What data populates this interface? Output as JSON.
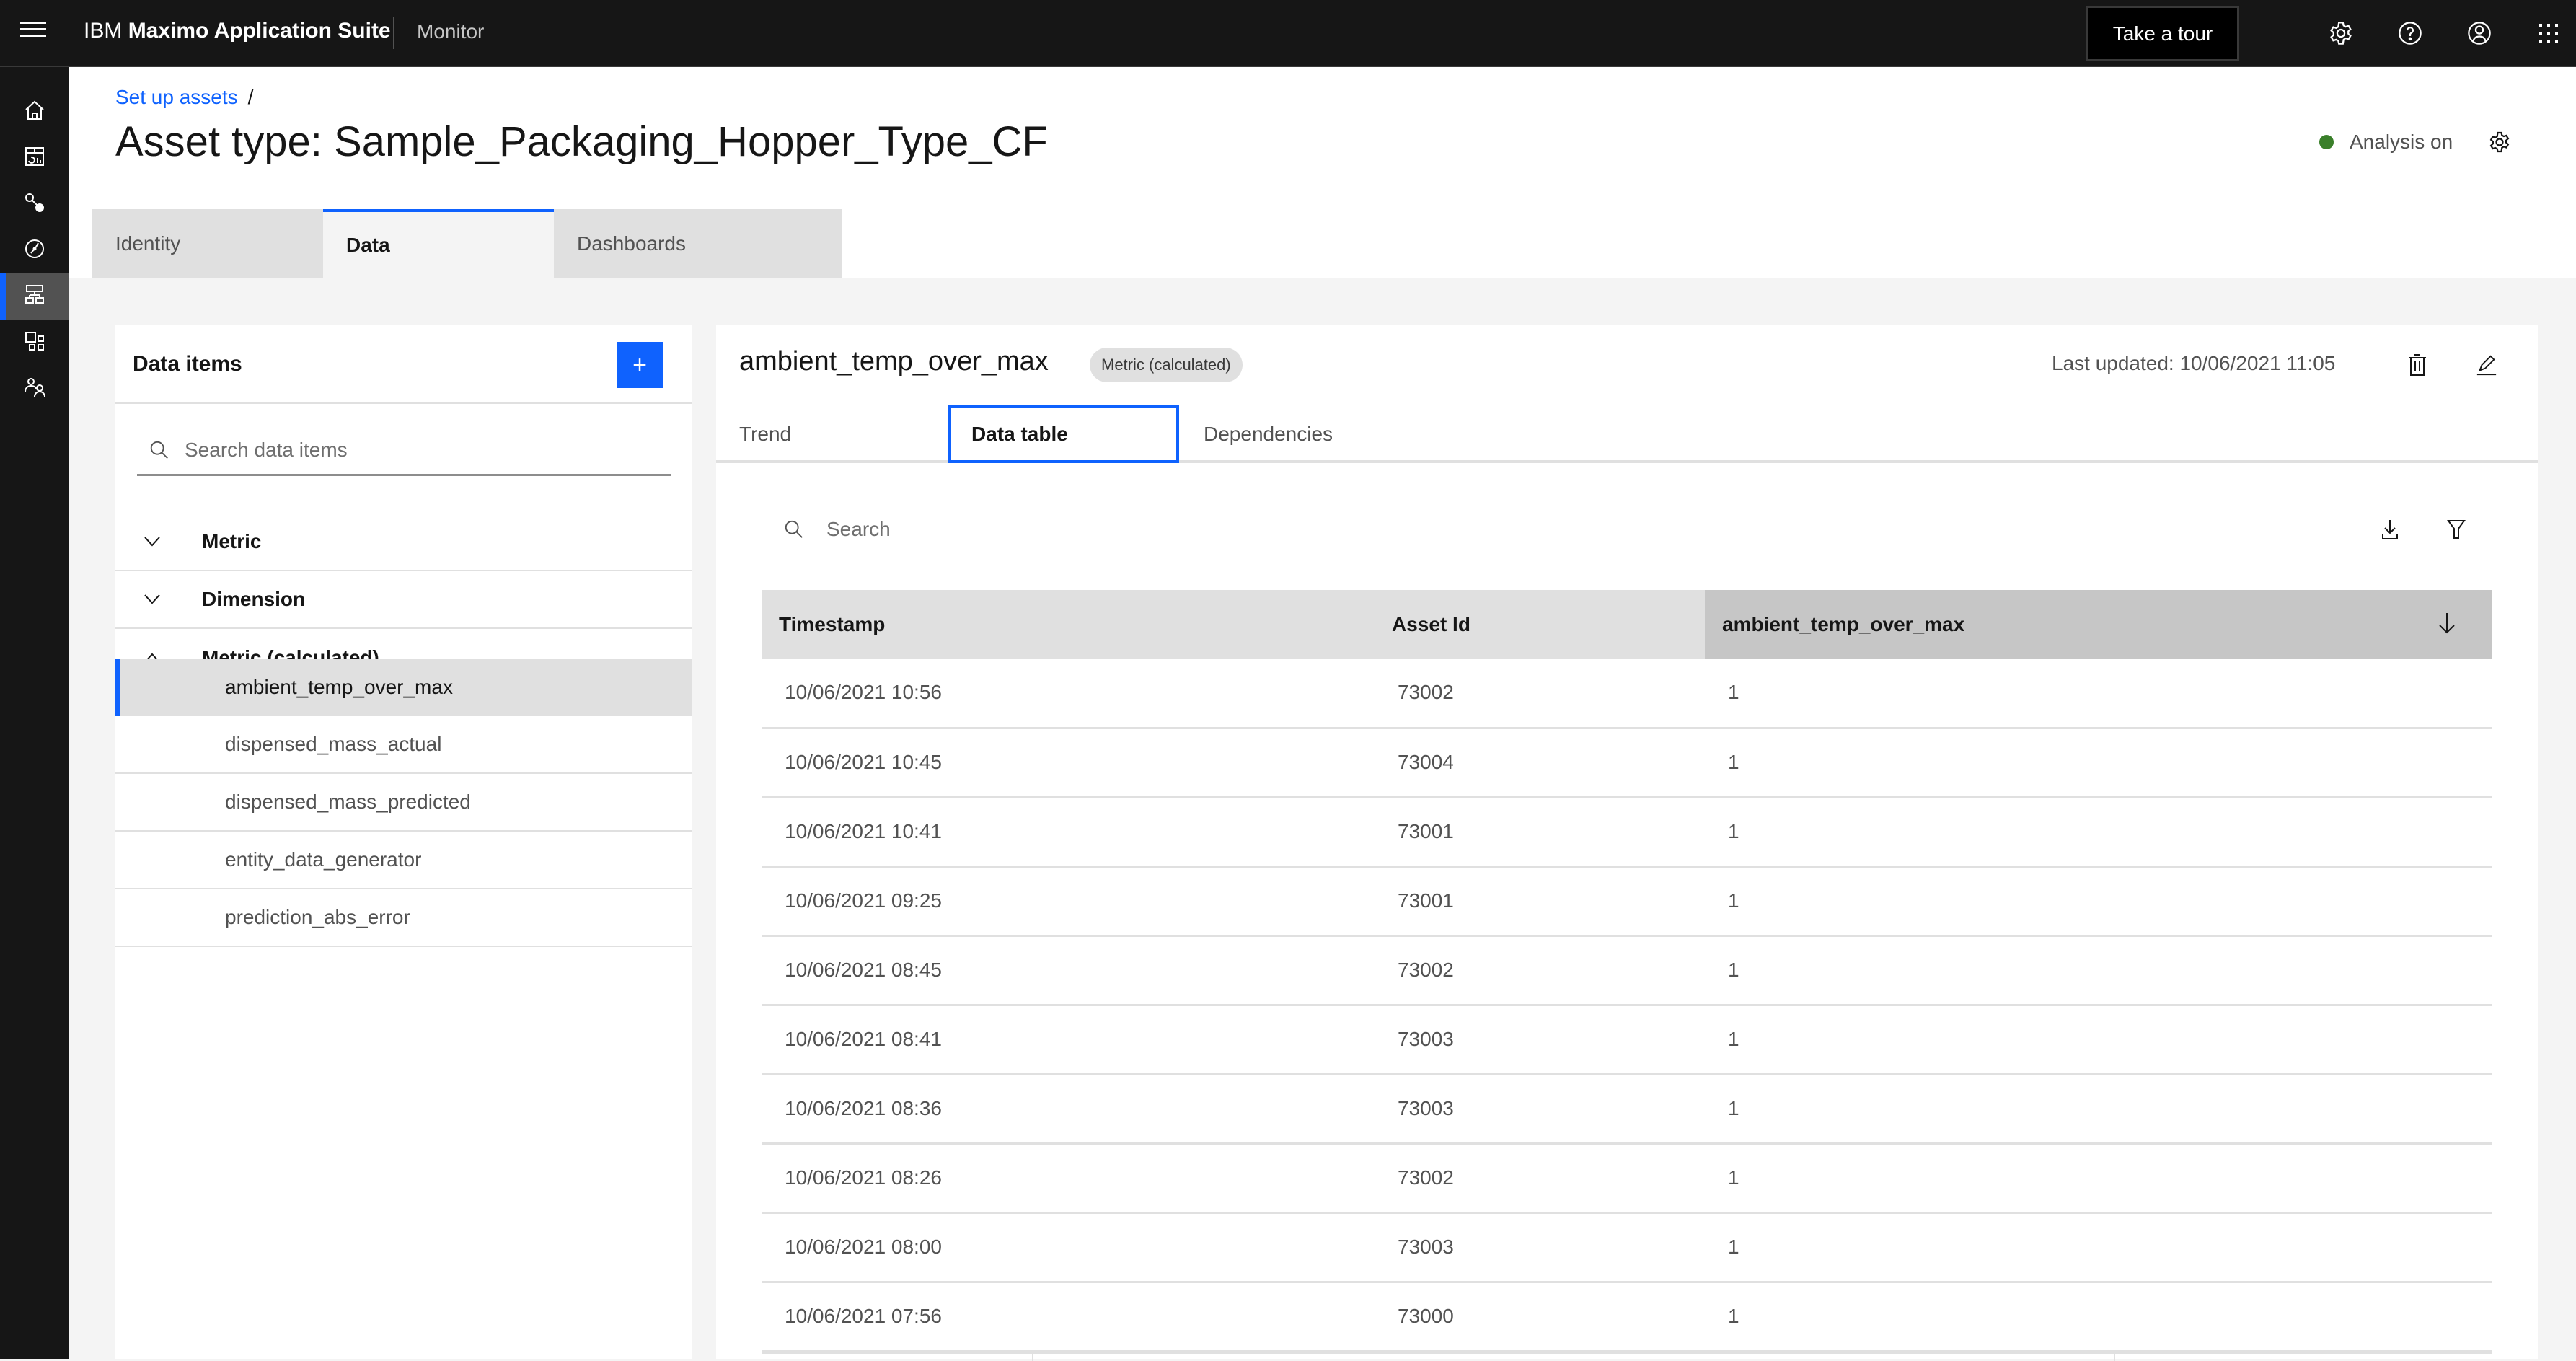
{
  "header": {
    "brand_ibm": "IBM",
    "brand_product": "Maximo Application Suite",
    "app_name": "Monitor",
    "tour_label": "Take a tour",
    "icons": [
      "settings-icon",
      "help-icon",
      "user-icon",
      "app-switcher-icon"
    ]
  },
  "sidenav": {
    "items": [
      {
        "icon": "home-icon",
        "active": false
      },
      {
        "icon": "dashboard-icon",
        "active": false
      },
      {
        "icon": "connect-icon",
        "active": false
      },
      {
        "icon": "compass-icon",
        "active": false
      },
      {
        "icon": "hierarchy-icon",
        "active": true
      },
      {
        "icon": "apps-icon",
        "active": false
      },
      {
        "icon": "users-icon",
        "active": false
      }
    ]
  },
  "breadcrumb": {
    "link": "Set up assets",
    "separator": "/"
  },
  "page": {
    "title": "Asset type: Sample_Packaging_Hopper_Type_CF",
    "status_label": "Analysis on",
    "status_color": "#3a7f2a",
    "tabs": [
      {
        "label": "Identity",
        "active": false
      },
      {
        "label": "Data",
        "active": true
      },
      {
        "label": "Dashboards",
        "active": false
      }
    ]
  },
  "data_items": {
    "title": "Data items",
    "add_label": "+",
    "search_placeholder": "Search data items",
    "categories": [
      {
        "label": "Metric",
        "expanded": false
      },
      {
        "label": "Dimension",
        "expanded": false
      },
      {
        "label": "Metric (calculated)",
        "expanded": true
      }
    ],
    "items": [
      {
        "label": "ambient_temp_over_max",
        "selected": true
      },
      {
        "label": "dispensed_mass_actual",
        "selected": false
      },
      {
        "label": "dispensed_mass_predicted",
        "selected": false
      },
      {
        "label": "entity_data_generator",
        "selected": false
      },
      {
        "label": "prediction_abs_error",
        "selected": false
      }
    ]
  },
  "detail": {
    "title": "ambient_temp_over_max",
    "tag": "Metric (calculated)",
    "last_updated": "Last updated: 10/06/2021 11:05",
    "tabs": [
      {
        "label": "Trend",
        "active": false
      },
      {
        "label": "Data table",
        "active": true
      },
      {
        "label": "Dependencies",
        "active": false
      }
    ],
    "search_placeholder": "Search",
    "table": {
      "columns": [
        "Timestamp",
        "Asset Id",
        "ambient_temp_over_max"
      ],
      "sorted_column": "ambient_temp_over_max",
      "sort_direction": "descending",
      "rows": [
        [
          "10/06/2021 10:56",
          "73002",
          "1"
        ],
        [
          "10/06/2021 10:45",
          "73004",
          "1"
        ],
        [
          "10/06/2021 10:41",
          "73001",
          "1"
        ],
        [
          "10/06/2021 09:25",
          "73001",
          "1"
        ],
        [
          "10/06/2021 08:45",
          "73002",
          "1"
        ],
        [
          "10/06/2021 08:41",
          "73003",
          "1"
        ],
        [
          "10/06/2021 08:36",
          "73003",
          "1"
        ],
        [
          "10/06/2021 08:26",
          "73002",
          "1"
        ],
        [
          "10/06/2021 08:00",
          "73003",
          "1"
        ],
        [
          "10/06/2021 07:56",
          "73000",
          "1"
        ]
      ]
    }
  },
  "colors": {
    "accent": "#0f62fe",
    "header_bg": "#161616",
    "page_bg": "#f4f4f4"
  }
}
